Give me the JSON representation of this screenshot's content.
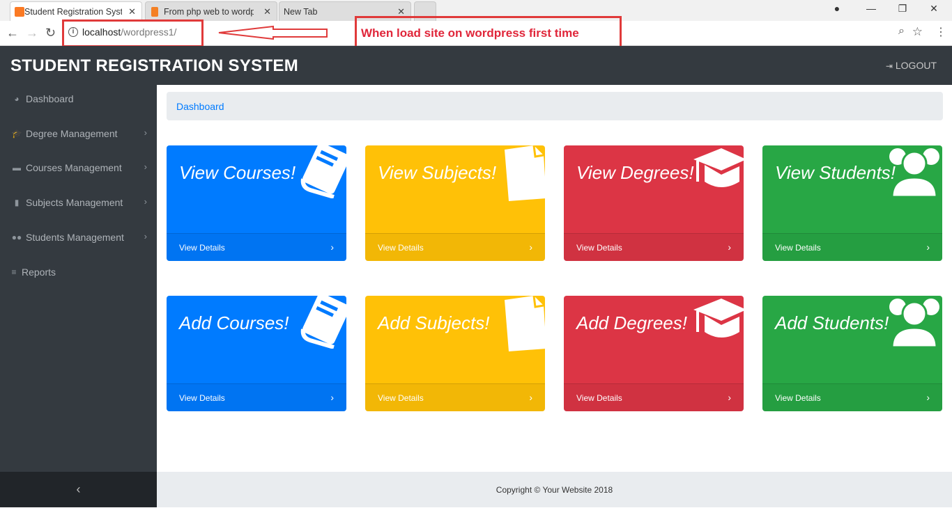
{
  "browser": {
    "tabs": [
      {
        "title": "Student Registration Syste",
        "close": "✕"
      },
      {
        "title": "From php web to wordpre",
        "close": "✕"
      },
      {
        "title": "New Tab",
        "close": "✕"
      }
    ],
    "url_host": "localhost",
    "url_path": "/wordpress1/"
  },
  "annotation": {
    "text": "When load site on wordpress first time"
  },
  "header": {
    "title": "STUDENT REGISTRATION SYSTEM",
    "logout": "LOGOUT"
  },
  "sidebar": {
    "items": [
      {
        "label": "Dashboard",
        "icon": "dashboard-icon",
        "has_arrow": false
      },
      {
        "label": "Degree Management",
        "icon": "graduation-cap-icon",
        "has_arrow": true
      },
      {
        "label": "Courses Management",
        "icon": "book-icon",
        "has_arrow": true
      },
      {
        "label": "Subjects Management",
        "icon": "file-icon",
        "has_arrow": true
      },
      {
        "label": "Students Management",
        "icon": "users-icon",
        "has_arrow": true
      },
      {
        "label": "Reports",
        "icon": "list-icon",
        "has_arrow": false
      }
    ],
    "collapse_glyph": "‹"
  },
  "breadcrumb": "Dashboard",
  "cards": [
    {
      "title": "View Courses!",
      "footer": "View Details",
      "color": "#007bff",
      "icon": "book-icon"
    },
    {
      "title": "View Subjects!",
      "footer": "View Details",
      "color": "#ffc107",
      "icon": "file-icon"
    },
    {
      "title": "View Degrees!",
      "footer": "View Details",
      "color": "#dc3545",
      "icon": "graduation-cap-icon"
    },
    {
      "title": "View Students!",
      "footer": "View Details",
      "color": "#28a745",
      "icon": "users-icon"
    },
    {
      "title": "Add Courses!",
      "footer": "View Details",
      "color": "#007bff",
      "icon": "book-icon"
    },
    {
      "title": "Add Subjects!",
      "footer": "View Details",
      "color": "#ffc107",
      "icon": "file-icon"
    },
    {
      "title": "Add Degrees!",
      "footer": "View Details",
      "color": "#dc3545",
      "icon": "graduation-cap-icon"
    },
    {
      "title": "Add Students!",
      "footer": "View Details",
      "color": "#28a745",
      "icon": "users-icon"
    }
  ],
  "footer": "Copyright © Your Website 2018"
}
